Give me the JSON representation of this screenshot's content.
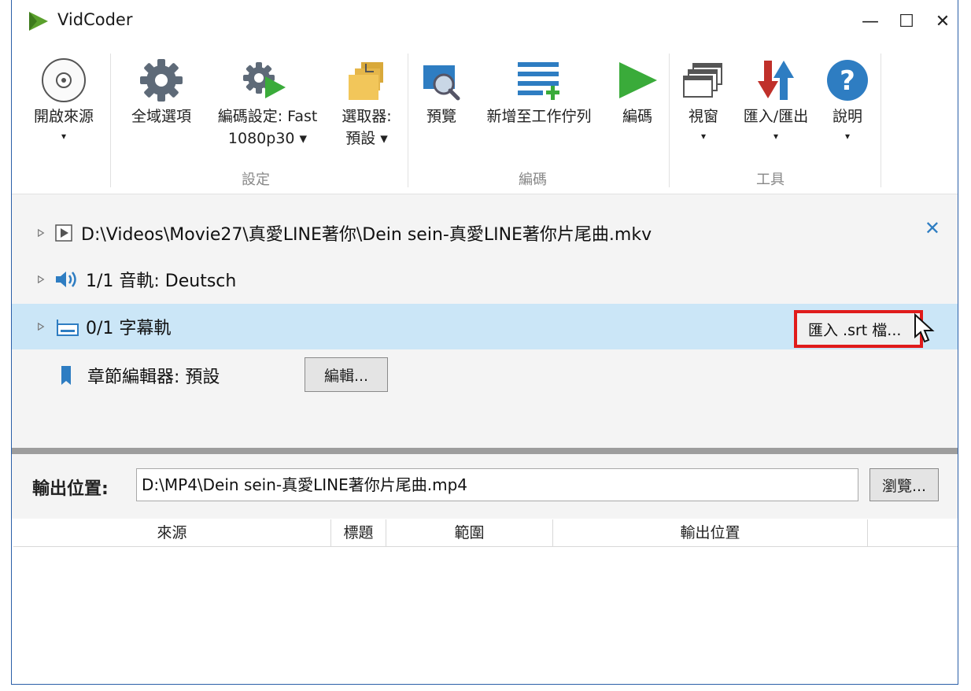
{
  "window": {
    "title": "VidCoder",
    "minimize": "—",
    "maximize": "☐",
    "close": "✕"
  },
  "ribbon": {
    "open_source": "開啟來源",
    "global_options": "全域選項",
    "encoding_settings_line1": "編碼設定: Fast",
    "encoding_settings_line2": "1080p30 ▾",
    "picker_line1": "選取器:",
    "picker_line2": "預設 ▾",
    "preview": "預覽",
    "add_to_queue": "新增至工作佇列",
    "encode": "編碼",
    "window": "視窗",
    "import_export": "匯入/匯出",
    "help": "說明",
    "caret": "▾",
    "groups": {
      "settings": "設定",
      "encoding": "編碼",
      "tools": "工具"
    }
  },
  "source": {
    "path": "D:\\Videos\\Movie27\\真愛LINE著你\\Dein sein-真愛LINE著你片尾曲.mkv",
    "audio": "1/1 音軌: Deutsch",
    "subtitle": "0/1 字幕軌",
    "import_srt": "匯入 .srt 檔...",
    "chapters": "章節編輯器: 預設",
    "edit_button": "編輯..."
  },
  "output": {
    "label": "輸出位置:",
    "value": "D:\\MP4\\Dein sein-真愛LINE著你片尾曲.mp4",
    "browse": "瀏覽..."
  },
  "queue": {
    "columns": [
      "來源",
      "標題",
      "範圍",
      "輸出位置"
    ]
  },
  "colors": {
    "accent": "#2e7dc2",
    "selected_row": "#cbe6f7",
    "highlight_box": "#e01b1b",
    "encode_green": "#3aab3a"
  }
}
